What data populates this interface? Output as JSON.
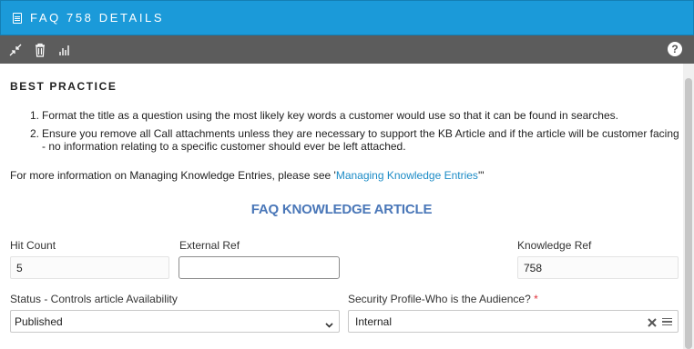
{
  "window": {
    "title": "FAQ 758 DETAILS",
    "title_icon": "document-icon"
  },
  "toolbar": {
    "icons": [
      "collapse-icon",
      "trash-icon",
      "stats-icon"
    ],
    "help_label": "?"
  },
  "best_practice": {
    "heading": "BEST PRACTICE",
    "items": [
      {
        "num": "1.",
        "text": "Format the title as a question using the most likely key words a customer would use so that it can be found in searches."
      },
      {
        "num": "2.",
        "text": "Ensure you remove all Call attachments unless they are necessary to support the KB Article and if the article will be customer facing - no information relating to a specific customer should ever be left attached."
      }
    ],
    "more_info_prefix": "For more information on Managing Knowledge Entries, please see '",
    "more_info_link": "Managing Knowledge Entries",
    "more_info_suffix": "'\""
  },
  "article": {
    "section_title": "FAQ KNOWLEDGE ARTICLE",
    "hit_count": {
      "label": "Hit Count",
      "value": "5"
    },
    "external_ref": {
      "label": "External Ref",
      "value": ""
    },
    "knowledge_ref": {
      "label": "Knowledge Ref",
      "value": "758"
    },
    "status": {
      "label": "Status - Controls article Availability",
      "value": "Published"
    },
    "security_profile": {
      "label": "Security Profile-Who is the Audience?",
      "required_mark": "*",
      "value": "Internal"
    }
  },
  "colors": {
    "header": "#1b9ad9",
    "toolbar": "#5c5c5c",
    "section_title": "#4a77b8",
    "link": "#1b8bc6",
    "required": "#e0313a"
  }
}
